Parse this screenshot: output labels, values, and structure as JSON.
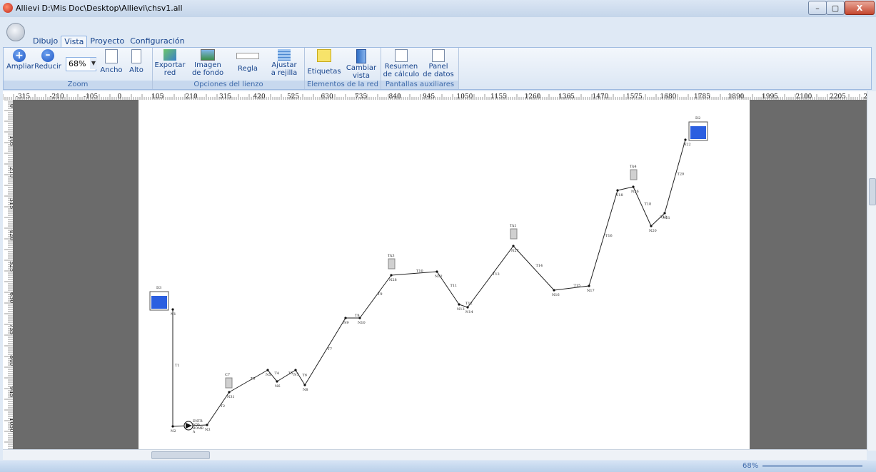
{
  "window": {
    "title": "Allievi  D:\\Mis Doc\\Desktop\\Allievi\\chsv1.all",
    "min": "–",
    "max": "▢",
    "close": "X"
  },
  "tabs": [
    "Dibujo",
    "Vista",
    "Proyecto",
    "Configuración"
  ],
  "ribbon": {
    "zoom_group": {
      "label": "Zoom",
      "ampliar": "Ampliar",
      "reducir": "Reducir",
      "zoom_value": "68%",
      "ancho": "Ancho",
      "alto": "Alto"
    },
    "canvas_group": {
      "label": "Opciones del lienzo",
      "exportar_1": "Exportar",
      "exportar_2": "red",
      "imagen_1": "Imagen",
      "imagen_2": "de fondo",
      "regla": "Regla",
      "ajustar_1": "Ajustar",
      "ajustar_2": "a rejilla"
    },
    "network_group": {
      "label": "Elementos de la red",
      "etiquetas": "Etiquetas",
      "cambiar_1": "Cambiar",
      "cambiar_2": "vista"
    },
    "aux_group": {
      "label": "Pantallas auxiliares",
      "resumen_1": "Resumen",
      "resumen_2": "de cálculo",
      "panel_1": "Panel",
      "panel_2": "de datos"
    }
  },
  "hruler_labels": [
    "-315",
    "-210",
    "-105",
    "0",
    "105",
    "210",
    "315",
    "420",
    "525",
    "630",
    "735",
    "840",
    "945",
    "1050",
    "1155",
    "1260",
    "1365",
    "1470",
    "1575",
    "1680",
    "1785",
    "1890",
    "1995",
    "2100",
    "2205",
    "2310"
  ],
  "vruler_labels": [
    "0",
    "105",
    "210",
    "315",
    "420",
    "525",
    "630",
    "735",
    "840",
    "945",
    "1050",
    "1155"
  ],
  "network": {
    "nodes": [
      "N1",
      "N2",
      "N3",
      "N31",
      "N5",
      "N6",
      "N7",
      "N8",
      "N9",
      "N10",
      "N28",
      "N12",
      "N13",
      "N14",
      "N27",
      "N16",
      "N17",
      "N18",
      "N26",
      "N20",
      "N21",
      "N22"
    ],
    "pipes": [
      "T1",
      "T2",
      "T3",
      "T4",
      "T5",
      "T6",
      "T7",
      "T8",
      "T9",
      "T10",
      "T11",
      "T12",
      "T13",
      "T14",
      "T15",
      "T16",
      "T18",
      "T19",
      "T20"
    ],
    "tanks": [
      "D3",
      "D2",
      "Tk1",
      "Tk3",
      "Tk4",
      "C7"
    ],
    "pump_label": "ENTR\nADA\nBOMB\nA"
  },
  "status": {
    "zoom": "68%"
  }
}
